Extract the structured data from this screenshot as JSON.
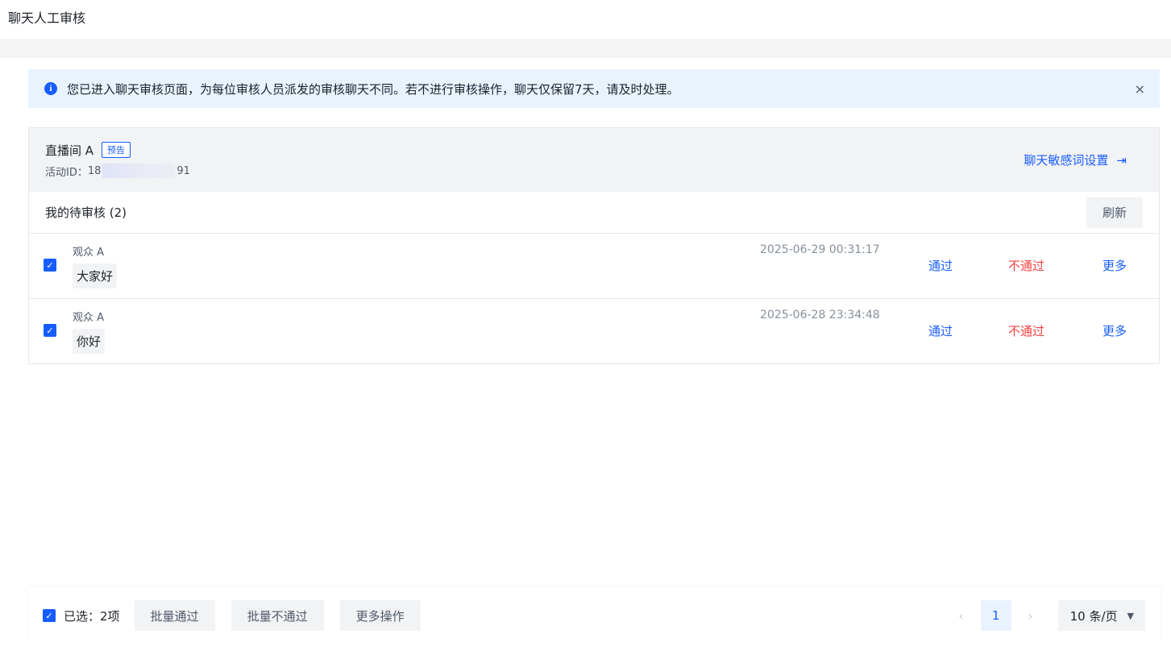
{
  "app": {
    "title": "聊天人工审核"
  },
  "notice": {
    "text": "您已进入聊天审核页面，为每位审核人员派发的审核聊天不同。若不进行审核操作，聊天仅保留7天，请及时处理。",
    "close": "×"
  },
  "room": {
    "name": "直播间 A",
    "tag": "预告",
    "id_label": "活动ID：",
    "id_prefix": "18",
    "id_suffix": "91",
    "sensitive_link": "聊天敏感词设置"
  },
  "pending": {
    "title": "我的待审核 (2)",
    "refresh": "刷新",
    "rows": [
      {
        "user": "观众 A",
        "message": "大家好",
        "time": "2025-06-29 00:31:17",
        "pass": "通过",
        "reject": "不通过",
        "more": "更多"
      },
      {
        "user": "观众 A",
        "message": "你好",
        "time": "2025-06-28 23:34:48",
        "pass": "通过",
        "reject": "不通过",
        "more": "更多"
      }
    ]
  },
  "footer": {
    "selected": "已选：2项",
    "batch_pass": "批量通过",
    "batch_reject": "批量不通过",
    "more_ops": "更多操作",
    "prev": "‹",
    "page": "1",
    "next": "›",
    "page_size": "10 条/页"
  },
  "colors": {
    "primary": "#165dff",
    "danger": "#f53f3f",
    "notice_bg": "#e8f3ff"
  }
}
